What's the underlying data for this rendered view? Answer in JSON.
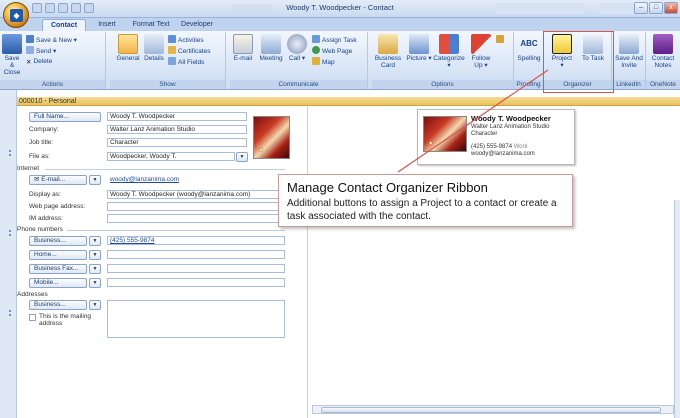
{
  "window": {
    "title": "Woody T. Woodpecker - Contact",
    "min": "–",
    "max": "□",
    "close": "x"
  },
  "tabs": [
    {
      "label": "Contact"
    },
    {
      "label": "Insert"
    },
    {
      "label": "Format Text"
    },
    {
      "label": "Developer"
    }
  ],
  "ribbon": {
    "actions": {
      "label": "Actions",
      "save_close": "Save & Close",
      "save_new": "Save & New",
      "send": "Send",
      "delete": "Delete"
    },
    "show": {
      "label": "Show",
      "general": "General",
      "details": "Details",
      "activities": "Activities",
      "certificates": "Certificates",
      "all_fields": "All Fields"
    },
    "communicate": {
      "label": "Communicate",
      "email": "E-mail",
      "meeting": "Meeting",
      "call": "Call",
      "assign_task": "Assign Task",
      "web_page": "Web Page",
      "map": "Map"
    },
    "options": {
      "label": "Options",
      "business_card": "Business Card",
      "picture": "Picture",
      "categorize": "Categorize",
      "follow_up": "Follow Up"
    },
    "proofing": {
      "label": "Proofing",
      "spelling": "Spelling"
    },
    "organizer": {
      "label": "Organizer",
      "project": "Project",
      "to_task": "To Task"
    },
    "linkedin": {
      "label": "LinkedIn",
      "save_invite": "Save And Invite"
    },
    "onenote": {
      "label": "OneNote",
      "contact_notes": "Contact Notes"
    }
  },
  "header": {
    "text": "000010 - Personal"
  },
  "form": {
    "full_name_button": "Full Name...",
    "full_name": "Woody T. Woodpecker",
    "company_label": "Company:",
    "company": "Walter Lanz Animation Studio",
    "job_title_label": "Job title:",
    "job_title": "Character",
    "file_as_label": "File as:",
    "file_as": "Woodpecker, Woody T.",
    "internet_section": "Internet",
    "email_button": "E-mail...",
    "email": "woody@lanzanima.com",
    "display_as_label": "Display as:",
    "display_as": "Woody T. Woodpecker (woody@lanzanima.com)",
    "web_page_label": "Web page address:",
    "im_label": "IM address:",
    "phone_section": "Phone numbers",
    "phones": [
      {
        "label": "Business...",
        "value": "(425) 555-9874"
      },
      {
        "label": "Home...",
        "value": ""
      },
      {
        "label": "Business Fax...",
        "value": ""
      },
      {
        "label": "Mobile...",
        "value": ""
      }
    ],
    "addresses_section": "Addresses",
    "address_button": "Business...",
    "mailing_checkbox": "This is the mailing address"
  },
  "business_card": {
    "name": "Woody T. Woodpecker",
    "company": "Walter Lanz Animation Studio",
    "title": "Character",
    "phone": "(425) 555-9874",
    "phone_type": "Work",
    "email": "woody@lanzanima.com"
  },
  "tooltip": {
    "title": "Manage Contact Organizer Ribbon",
    "body": "Additional buttons to assign a Project to a contact or create a task associated with the contact."
  },
  "colors": {
    "callout_border": "#d9534f",
    "header_strip": "#e9c35a",
    "link": "#1f49a8"
  }
}
